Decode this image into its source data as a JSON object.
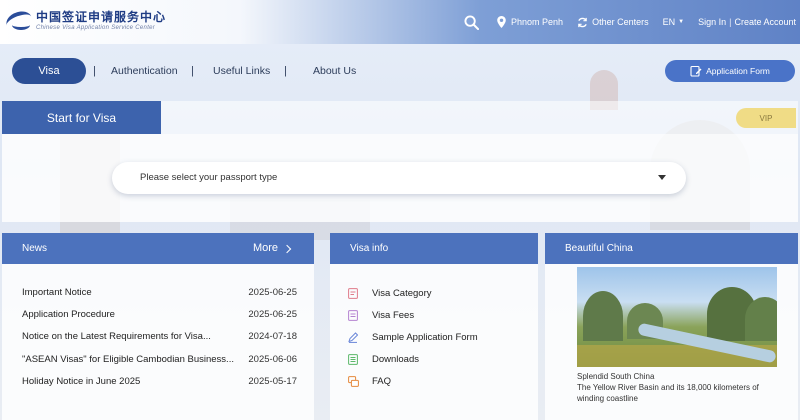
{
  "header": {
    "logo_cn": "中国签证申请服务中心",
    "logo_en": "Chinese Visa Application Service Center",
    "location": "Phnom Penh",
    "other_centers": "Other Centers",
    "language": "EN",
    "sign_in": "Sign In",
    "separator": "|",
    "create_account": "Create Account"
  },
  "nav": {
    "items": [
      {
        "label": "Visa"
      },
      {
        "label": "Authentication"
      },
      {
        "label": "Useful Links"
      },
      {
        "label": "About Us"
      }
    ],
    "separator": "|",
    "application_form": "Application Form"
  },
  "start": {
    "tab_label": "Start for Visa",
    "vip_label": "VIP",
    "passport_placeholder": "Please select your passport type"
  },
  "news": {
    "title": "News",
    "more": "More",
    "items": [
      {
        "title": "Important Notice",
        "date": "2025-06-25"
      },
      {
        "title": "Application Procedure",
        "date": "2025-06-25"
      },
      {
        "title": "Notice on the Latest  Requirements  for Visa...",
        "date": "2024-07-18"
      },
      {
        "title": "\"ASEAN Visas\" for Eligible Cambodian Business...",
        "date": "2025-06-06"
      },
      {
        "title": "Holiday Notice in June 2025",
        "date": "2025-05-17"
      }
    ]
  },
  "visa_info": {
    "title": "Visa info",
    "items": [
      {
        "label": "Visa Category",
        "icon": "visa-category-icon"
      },
      {
        "label": "Visa Fees",
        "icon": "visa-fees-icon"
      },
      {
        "label": "Sample Application Form",
        "icon": "sample-form-icon"
      },
      {
        "label": "Downloads",
        "icon": "downloads-icon"
      },
      {
        "label": "FAQ",
        "icon": "faq-icon"
      }
    ]
  },
  "beautiful_china": {
    "title": "Beautiful China",
    "caption_title": "Splendid South China",
    "caption_text": "The Yellow River Basin and its 18,000 kilometers of winding coastline"
  },
  "colors": {
    "primary": "#2c4f95",
    "panel_header": "#4c72bd",
    "vip": "#f0dc86"
  }
}
